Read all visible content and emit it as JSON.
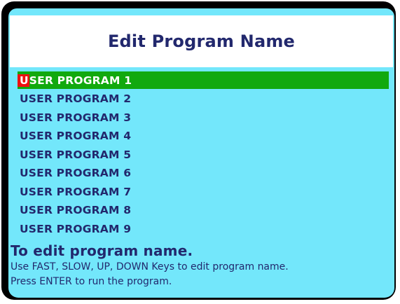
{
  "screen": {
    "title": "Edit Program Name",
    "programs": [
      {
        "cursor_char": "U",
        "rest": "SER PROGRAM 1",
        "selected": true
      },
      {
        "label": "USER PROGRAM 2"
      },
      {
        "label": "USER PROGRAM 3"
      },
      {
        "label": "USER PROGRAM 4"
      },
      {
        "label": "USER PROGRAM 5"
      },
      {
        "label": "USER PROGRAM 6"
      },
      {
        "label": "USER PROGRAM 7"
      },
      {
        "label": "USER PROGRAM 8"
      },
      {
        "label": "USER PROGRAM 9"
      }
    ],
    "help": {
      "title": "To edit program name.",
      "line1": "Use FAST, SLOW, UP, DOWN Keys to edit program name.",
      "line2": "Press ENTER to run the program."
    }
  },
  "colors": {
    "frame": "#000000",
    "screen_background": "#73e7fb",
    "header_background": "#ffffff",
    "text": "#22286d",
    "selected_row": "#11a90e",
    "cursor": "#ee1111"
  }
}
